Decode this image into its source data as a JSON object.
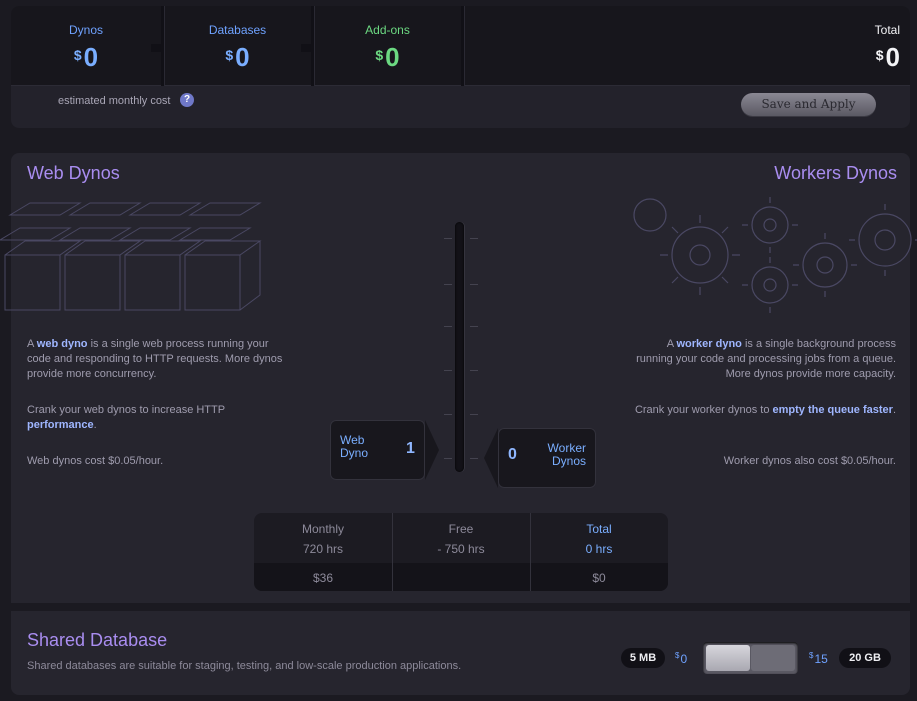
{
  "costs": {
    "dynos": {
      "label": "Dynos",
      "currency": "$",
      "amount": "0"
    },
    "databases": {
      "label": "Databases",
      "currency": "$",
      "amount": "0"
    },
    "addons": {
      "label": "Add-ons",
      "currency": "$",
      "amount": "0"
    },
    "total": {
      "label": "Total",
      "currency": "$",
      "amount": "0"
    },
    "estimate_label": "estimated monthly cost",
    "help_glyph": "?",
    "save_label": "Save and Apply"
  },
  "web": {
    "title": "Web Dynos",
    "p1_pre": "A ",
    "p1_bold": "web dyno",
    "p1_post": " is a single web process running your code and responding to HTTP requests. More dynos provide more concurrency.",
    "p2_pre": "Crank your web dynos to increase HTTP ",
    "p2_bold": "performance",
    "p2_post": ".",
    "p3": "Web dynos cost $0.05/hour.",
    "counter_label_1": "Web",
    "counter_label_2": "Dyno",
    "count": "1"
  },
  "workers": {
    "title": "Workers Dynos",
    "p1_pre": "A ",
    "p1_bold": "worker dyno",
    "p1_post": " is a single background process running your code and processing jobs from a queue. More dynos provide more capacity.",
    "p2_pre": "Crank your worker dynos to ",
    "p2_bold": "empty the queue faster",
    "p2_post": ".",
    "p3": "Worker dynos also cost $0.05/hour.",
    "counter_label_1": "Worker",
    "counter_label_2": "Dynos",
    "count": "0"
  },
  "hours": {
    "monthly": {
      "label": "Monthly",
      "value": "720 hrs",
      "cost": "$36"
    },
    "free": {
      "label": "Free",
      "value": "- 750 hrs",
      "cost": ""
    },
    "total": {
      "label": "Total",
      "value": "0 hrs",
      "cost": "$0"
    }
  },
  "database": {
    "title": "Shared Database",
    "description": "Shared databases are suitable for staging, testing, and low-scale production applications.",
    "min_size": "5 MB",
    "min_currency": "$",
    "min_price": "0",
    "max_currency": "$",
    "max_price": "15",
    "max_size": "20 GB",
    "toggle_position": 0
  },
  "colors": {
    "accent_purple": "#a98df0",
    "accent_blue": "#6fa2ff",
    "accent_green": "#6cd982"
  },
  "icons": [
    "help-icon",
    "server-cubes-illustration",
    "gears-illustration"
  ]
}
